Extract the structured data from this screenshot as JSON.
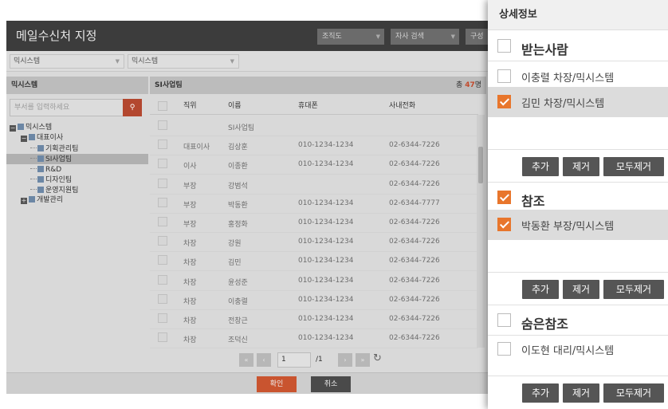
{
  "dialog": {
    "title": "메일수신처 지정",
    "top_selects": [
      "조직도",
      "자사 검색",
      "구성"
    ],
    "dropdowns": [
      "믹시스템",
      "믹시스템"
    ]
  },
  "tree_panel": {
    "header": "믹시스템",
    "search_placeholder": "부서를 입력하세요",
    "search_icon": "search-icon",
    "nodes": [
      {
        "label": "믹시스템",
        "toggle": "−"
      },
      {
        "label": "대표이사",
        "toggle": "−"
      },
      {
        "label": "기획관리팀"
      },
      {
        "label": "SI사업팀",
        "selected": true
      },
      {
        "label": "R&D"
      },
      {
        "label": "디자인팀"
      },
      {
        "label": "운영지원팀"
      },
      {
        "label": "개발관리",
        "toggle": "+"
      }
    ]
  },
  "grid": {
    "title": "SI사업팀",
    "count_prefix": "총",
    "count": "47",
    "count_suffix": "명",
    "columns": [
      "직위",
      "이름",
      "휴대폰",
      "사내전화"
    ],
    "rows": [
      {
        "pos": "",
        "name": "SI사업팀",
        "mobile": "",
        "tel": ""
      },
      {
        "pos": "대표이사",
        "name": "김상훈",
        "mobile": "010-1234-1234",
        "tel": "02-6344-7226"
      },
      {
        "pos": "이사",
        "name": "이종환",
        "mobile": "010-1234-1234",
        "tel": "02-6344-7226"
      },
      {
        "pos": "부장",
        "name": "강범석",
        "mobile": "",
        "tel": "02-6344-7226"
      },
      {
        "pos": "부장",
        "name": "박동환",
        "mobile": "010-1234-1234",
        "tel": "02-6344-7777"
      },
      {
        "pos": "부장",
        "name": "홍정화",
        "mobile": "010-1234-1234",
        "tel": "02-6344-7226"
      },
      {
        "pos": "차장",
        "name": "강원",
        "mobile": "010-1234-1234",
        "tel": "02-6344-7226"
      },
      {
        "pos": "차장",
        "name": "김민",
        "mobile": "010-1234-1234",
        "tel": "02-6344-7226"
      },
      {
        "pos": "차장",
        "name": "윤성준",
        "mobile": "010-1234-1234",
        "tel": "02-6344-7226"
      },
      {
        "pos": "차장",
        "name": "이충렬",
        "mobile": "010-1234-1234",
        "tel": "02-6344-7226"
      },
      {
        "pos": "차장",
        "name": "전창근",
        "mobile": "010-1234-1234",
        "tel": "02-6344-7226"
      },
      {
        "pos": "차장",
        "name": "조덕신",
        "mobile": "010-1234-1234",
        "tel": "02-6344-7226"
      }
    ],
    "pager": {
      "first_icon": "double-left-icon",
      "prev_icon": "chevron-left-icon",
      "next_icon": "chevron-right-icon",
      "last_icon": "double-right-icon",
      "page": "1",
      "total": "/1",
      "refresh_icon": "refresh-icon"
    }
  },
  "footer": {
    "confirm": "확인",
    "cancel": "취소",
    "confirm_color": "#c9542f",
    "cancel_color": "#4a4a4a"
  },
  "detail": {
    "title": "상세정보",
    "accent": "#e8762c",
    "sections": [
      {
        "label": "받는사람",
        "checked": false,
        "items": [
          {
            "label": "이충렬 차장/믹시스템",
            "checked": false,
            "highlighted": false
          },
          {
            "label": "김민 차장/믹시스템",
            "checked": true,
            "highlighted": true
          }
        ]
      },
      {
        "label": "참조",
        "checked": true,
        "items": [
          {
            "label": "박동환 부장/믹시스템",
            "checked": true,
            "highlighted": true
          }
        ]
      },
      {
        "label": "숨은참조",
        "checked": false,
        "items": [
          {
            "label": "이도현 대리/믹시스템",
            "checked": false,
            "highlighted": false
          }
        ]
      }
    ],
    "buttons": {
      "add": "추가",
      "remove": "제거",
      "remove_all": "모두제거"
    }
  }
}
